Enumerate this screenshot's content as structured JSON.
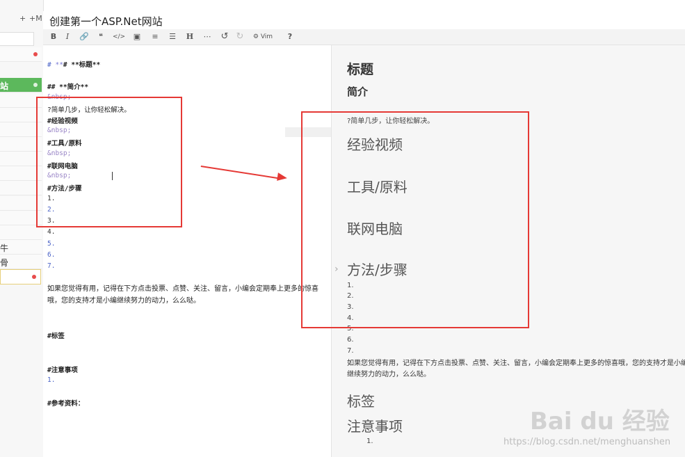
{
  "sidebar": {
    "top_buttons": [
      "+",
      "+M"
    ],
    "rows": [
      {
        "label": "",
        "dot": true,
        "state": "normal"
      },
      {
        "label": "站",
        "dot": true,
        "state": "active"
      },
      {
        "label": "",
        "dot": false,
        "state": "normal"
      },
      {
        "label": "",
        "dot": false,
        "state": "normal"
      },
      {
        "label": "",
        "dot": false,
        "state": "normal"
      },
      {
        "label": "",
        "dot": false,
        "state": "normal"
      },
      {
        "label": "",
        "dot": false,
        "state": "normal"
      },
      {
        "label": "",
        "dot": false,
        "state": "normal"
      },
      {
        "label": "",
        "dot": false,
        "state": "normal"
      },
      {
        "label": "",
        "dot": false,
        "state": "normal"
      },
      {
        "label": "",
        "dot": false,
        "state": "normal"
      },
      {
        "label": "",
        "dot": false,
        "state": "normal"
      },
      {
        "label": "牛",
        "dot": false,
        "state": "normal"
      },
      {
        "label": "骨",
        "dot": false,
        "state": "normal"
      },
      {
        "label": "",
        "dot": true,
        "state": "selected"
      }
    ]
  },
  "title": "创建第一个ASP.Net网站",
  "toolbar": {
    "bold": "B",
    "italic": "I",
    "link": "🔗",
    "quote": "❝",
    "code": "</>",
    "image": "▣",
    "ol": "≡",
    "ul": "☰",
    "heading": "H",
    "hr": "⋯",
    "undo": "↺",
    "redo": "↻",
    "vim": "⚙ Vim",
    "help": "?"
  },
  "editor": {
    "l1": "# **标题**",
    "l2": "## **简介**",
    "l3": "&nbsp;",
    "l4": "?简单几步，让你轻松解决。",
    "l5": "#经验视频",
    "l6": "&nbsp;",
    "l7": "#工具/原料",
    "l8": "&nbsp;",
    "l9": "#联网电脑",
    "l10": "&nbsp;",
    "l11": "#方法/步骤",
    "n1": "1.",
    "n2": "2.",
    "n3": "3.",
    "n4": "4.",
    "n5": "5.",
    "n6": "6.",
    "n7": "7.",
    "para": "如果您觉得有用，记得在下方点击投票、点赞、关注、留言，小编会定期奉上更多的惊喜哦，您的支持才是小编继续努力的动力，么么哒。",
    "tags": "#标签",
    "notes": "#注意事项",
    "notes1": "1.",
    "refs": "#参考资料："
  },
  "preview": {
    "h1": "标题",
    "h2": "简介",
    "intro": "?简单几步，让你轻松解决。",
    "s1": "经验视频",
    "s2": "工具/原料",
    "s3": "联网电脑",
    "s4": "方法/步骤",
    "n1": "1.",
    "n2": "2.",
    "n3": "3.",
    "n4": "4.",
    "n5": "5.",
    "n6": "6.",
    "n7": "7.",
    "para": "如果您觉得有用，记得在下方点击投票、点赞、关注、留言，小编会定期奉上更多的惊喜哦，您的支持才是小编继续努力的动力，么么哒。",
    "tags": "标签",
    "notes": "注意事项",
    "notes1": "1."
  },
  "watermark": {
    "logo": "Bai du 经验",
    "url": "https://blog.csdn.net/menghuanshen"
  },
  "colors": {
    "accent_green": "#5cb85c",
    "annotation_red": "#e53935",
    "dot_red": "#e84c4c"
  }
}
